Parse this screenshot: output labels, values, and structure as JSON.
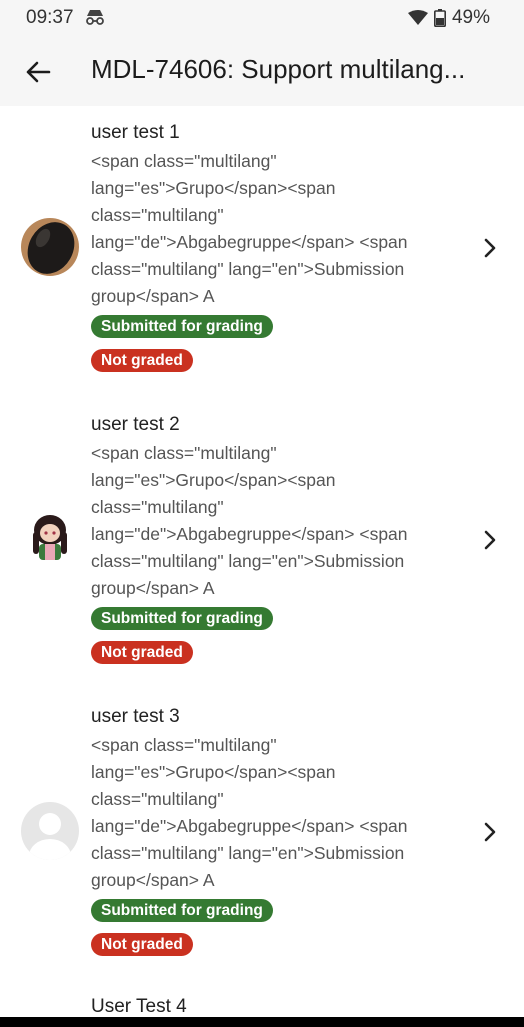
{
  "status_bar": {
    "time": "09:37",
    "battery": "49%"
  },
  "app_bar": {
    "title": "MDL-74606: Support multilang..."
  },
  "submissions": [
    {
      "name": "user test 1",
      "group": "<span class=\"multilang\" lang=\"es\">Grupo</span><span class=\"multilang\" lang=\"de\">Abgabegruppe</span> <span class=\"multilang\" lang=\"en\">Submission group</span> A",
      "status": "Submitted for grading",
      "grade_status": "Not graded",
      "avatar": "photo-dark-avatar"
    },
    {
      "name": "user test 2",
      "group": "<span class=\"multilang\" lang=\"es\">Grupo</span><span class=\"multilang\" lang=\"de\">Abgabegruppe</span> <span class=\"multilang\" lang=\"en\">Submission group</span> A",
      "status": "Submitted for grading",
      "grade_status": "Not graded",
      "avatar": "anime-figure-avatar"
    },
    {
      "name": "user test 3",
      "group": "<span class=\"multilang\" lang=\"es\">Grupo</span><span class=\"multilang\" lang=\"de\">Abgabegruppe</span> <span class=\"multilang\" lang=\"en\">Submission group</span> A",
      "status": "Submitted for grading",
      "grade_status": "Not graded",
      "avatar": "default-user-avatar"
    }
  ],
  "partial_item": {
    "name": "User Test 4"
  },
  "colors": {
    "submitted_badge": "#357a32",
    "not_graded_badge": "#ca3120",
    "bar_background": "#f6f6f6"
  }
}
